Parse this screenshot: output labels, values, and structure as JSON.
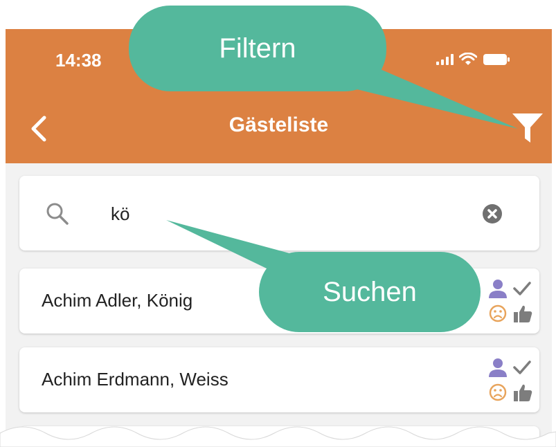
{
  "status_bar": {
    "time": "14:38"
  },
  "nav": {
    "title": "Gästeliste"
  },
  "search": {
    "value": "kö",
    "placeholder": ""
  },
  "guests": [
    {
      "name": "Achim Adler, König"
    },
    {
      "name": "Achim Erdmann, Weiss"
    }
  ],
  "callouts": {
    "filter": "Filtern",
    "search": "Suchen"
  },
  "colors": {
    "header": "#dc8142",
    "callout": "#54b89c",
    "person_icon": "#8a7fc7",
    "sad_icon": "#e8a45c",
    "status_icon": "#7d7d7d"
  },
  "icons": [
    "back-icon",
    "filter-icon",
    "search-icon",
    "clear-icon",
    "person-icon",
    "check-icon",
    "sad-face-icon",
    "thumbs-up-icon"
  ]
}
